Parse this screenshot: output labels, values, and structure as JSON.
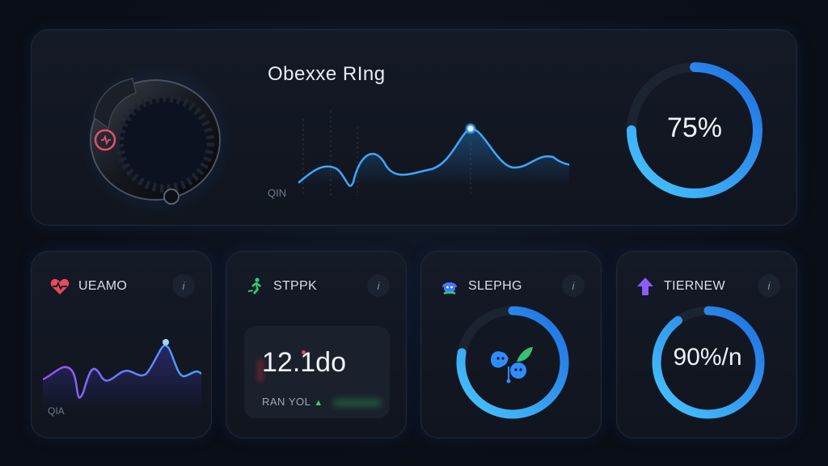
{
  "hero": {
    "title": "Obexxe RIng",
    "axis_label": "QIN",
    "gauge_value": "75%",
    "gauge_fraction": 0.75,
    "accent": "#2f9bff"
  },
  "cards": [
    {
      "title": "UEAMO",
      "icon": "heart-pulse-icon",
      "icon_color": "#e84a5f",
      "axis_label": "QIA"
    },
    {
      "title": "STPPK",
      "icon": "running-icon",
      "icon_color": "#2ecc71",
      "value": "12.1do",
      "subtitle": "RAN YOL"
    },
    {
      "title": "SLEPHG",
      "icon": "sleep-icon",
      "icon_color": "#7b5cff",
      "gauge_fraction": 0.78
    },
    {
      "title": "TIERNEW",
      "icon": "arrow-up-icon",
      "icon_color": "#8b5cf6",
      "gauge_value": "90%/n",
      "gauge_fraction": 0.9
    }
  ],
  "info_label": "i",
  "colors": {
    "background": "#0a0e17",
    "panel": "#141a26",
    "accent_blue": "#2f9bff",
    "accent_purple": "#9b4dff"
  }
}
